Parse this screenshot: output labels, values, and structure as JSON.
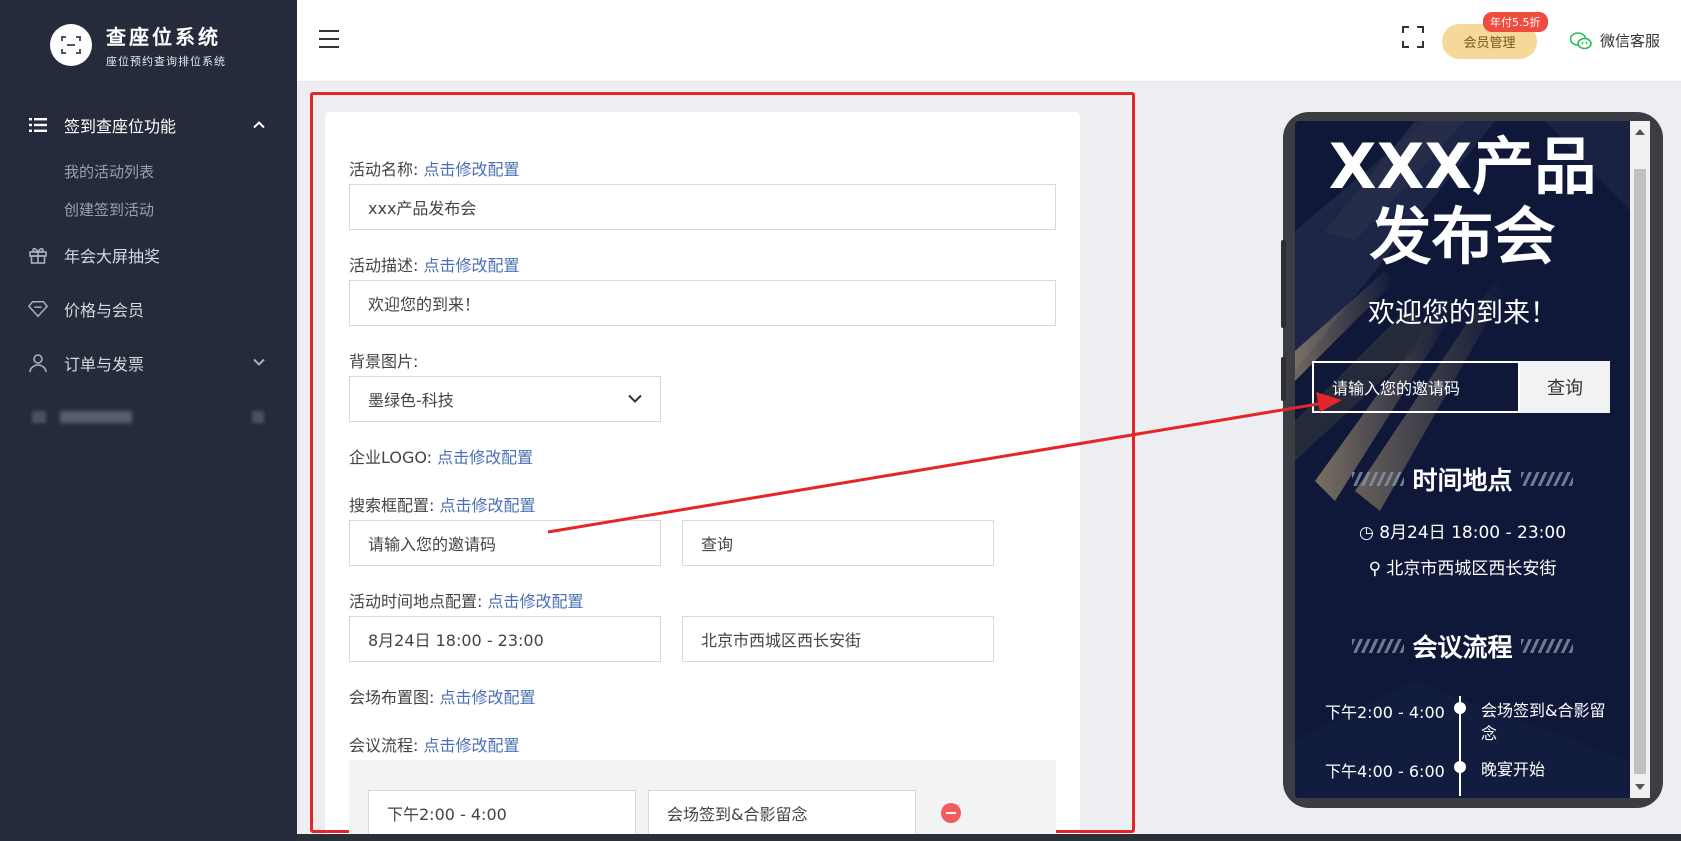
{
  "brand": {
    "title": "查座位系统",
    "subtitle": "座位预约查询排位系统"
  },
  "sidebar": {
    "items": [
      {
        "label": "签到查座位功能",
        "icon": "list-icon",
        "expanded": true
      },
      {
        "label": "年会大屏抽奖",
        "icon": "gift-icon"
      },
      {
        "label": "价格与会员",
        "icon": "diamond-icon"
      },
      {
        "label": "订单与发票",
        "icon": "user-icon"
      }
    ],
    "sub_items": [
      "我的活动列表",
      "创建签到活动"
    ]
  },
  "header": {
    "member_button": "会员管理",
    "discount_badge": "年付5.5折",
    "wechat_service": "微信客服"
  },
  "form": {
    "edit_link": "点击修改配置",
    "name_label": "活动名称:",
    "name_value": "xxx产品发布会",
    "desc_label": "活动描述:",
    "desc_value": "欢迎您的到来！",
    "bg_label": "背景图片:",
    "bg_value": "墨绿色-科技",
    "logo_label": "企业LOGO:",
    "search_label": "搜索框配置:",
    "search_placeholder_value": "请输入您的邀请码",
    "search_button_value": "查询",
    "time_label": "活动时间地点配置:",
    "time_value": "8月24日 18:00 - 23:00",
    "place_value": "北京市西城区西长安街",
    "layout_label": "会场布置图:",
    "agenda_label": "会议流程:",
    "agenda_row_time": "下午2:00 - 4:00",
    "agenda_row_title": "会场签到&合影留念"
  },
  "preview": {
    "title_line1": "XXX产品",
    "title_line2": "发布会",
    "description": "欢迎您的到来！",
    "search_placeholder": "请输入您的邀请码",
    "search_button": "查询",
    "section_time_place": "时间地点",
    "time": "8月24日 18:00 - 23:00",
    "place": "北京市西城区西长安街",
    "section_agenda": "会议流程",
    "agenda": [
      {
        "time": "下午2:00 - 4:00",
        "title": "会场签到&合影留念"
      },
      {
        "time": "下午4:00 - 6:00",
        "title": "晚宴开始"
      }
    ]
  },
  "colors": {
    "sidebar_bg": "#252b3b",
    "link": "#4a6fb5",
    "highlight_frame": "#e3262a",
    "preview_bg": "#0f1838",
    "member_button": "#f6d89a"
  }
}
